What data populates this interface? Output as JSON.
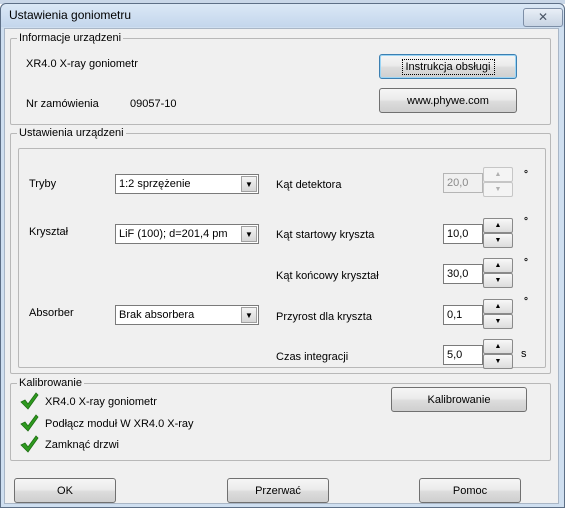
{
  "window": {
    "title": "Ustawienia goniometru",
    "close_glyph": "✕"
  },
  "device_info": {
    "group_label": "Informacje urządzeni",
    "device_name": "XR4.0 X-ray goniometr",
    "order_label": "Nr zamówienia",
    "order_number": "09057-10",
    "manual_button": "Instrukcja obsługi",
    "website_button": "www.phywe.com"
  },
  "device_settings": {
    "group_label": "Ustawienia urządzeni",
    "mode": {
      "label": "Tryby",
      "value": "1:2 sprzężenie"
    },
    "crystal": {
      "label": "Kryształ",
      "value": "LiF (100); d=201,4 pm"
    },
    "absorber": {
      "label": "Absorber",
      "value": "Brak absorbera"
    },
    "detector_angle": {
      "label": "Kąt detektora",
      "value": "20,0",
      "unit": "°"
    },
    "start_angle": {
      "label": "Kąt startowy kryszta",
      "value": "10,0",
      "unit": "°"
    },
    "end_angle": {
      "label": "Kąt końcowy kryształ",
      "value": "30,0",
      "unit": "°"
    },
    "increment": {
      "label": "Przyrost dla kryszta",
      "value": "0,1",
      "unit": "°"
    },
    "integration_time": {
      "label": "Czas integracji",
      "value": "5,0",
      "unit": "s"
    }
  },
  "calibration": {
    "group_label": "Kalibrowanie",
    "items": [
      "XR4.0 X-ray goniometr",
      "Podłącz moduł W XR4.0 X-ray",
      "Zamknąć drzwi"
    ],
    "button": "Kalibrowanie"
  },
  "footer": {
    "ok": "OK",
    "cancel": "Przerwać",
    "help": "Pomoc"
  },
  "icons": {
    "combo_arrow": "▼",
    "spin_up": "▲",
    "spin_down": "▼",
    "check": "checkmark-icon"
  },
  "colors": {
    "check_green": "#2e9a1f",
    "titlebar": "#c4d6ec"
  }
}
